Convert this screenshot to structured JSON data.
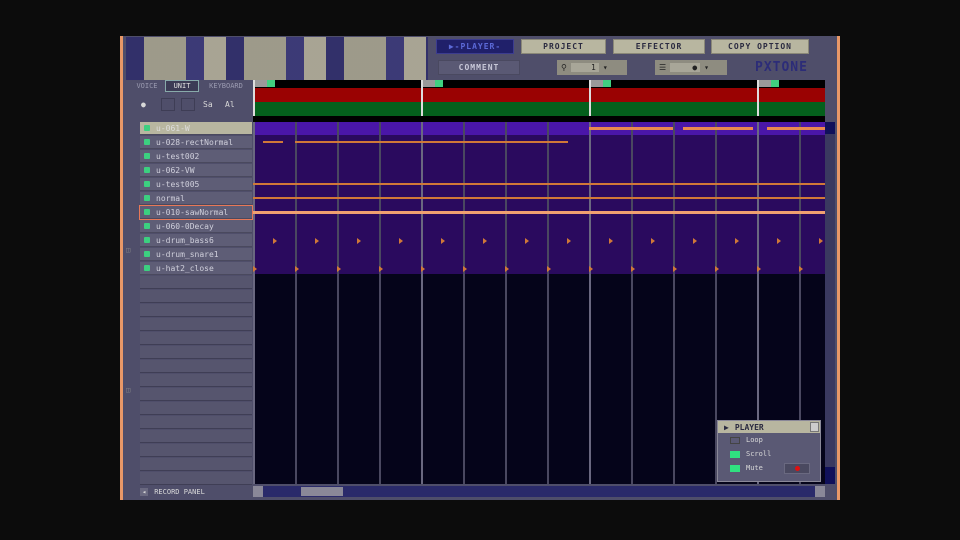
{
  "toolbar": {
    "player": "▶-PLAYER-",
    "project": "PROJECT",
    "effector": "EFFECTOR",
    "copy_option": "COPY OPTION",
    "comment": "COMMENT",
    "zoom_value": "1",
    "logo": "PXTONE"
  },
  "tabs": [
    {
      "label": "VOICE"
    },
    {
      "label": "UNIT"
    },
    {
      "label": "KEYBOARD"
    }
  ],
  "unit_tools": {
    "sa": "Sa",
    "al": "Al"
  },
  "units": [
    {
      "name": "u-061-W"
    },
    {
      "name": "u-028-rectNormal"
    },
    {
      "name": "u-test002"
    },
    {
      "name": "u-062-VW"
    },
    {
      "name": "u-test005"
    },
    {
      "name": "normal"
    },
    {
      "name": "u-010-sawNormal"
    },
    {
      "name": "u-060-0Decay"
    },
    {
      "name": "u-drum_bass6"
    },
    {
      "name": "u-drum_snare1"
    },
    {
      "name": "u-hat2_close"
    }
  ],
  "footer": {
    "record_panel": "RECORD PANEL"
  },
  "player_panel": {
    "title": "PLAYER",
    "loop": "Loop",
    "scroll": "Scroll",
    "mute": "Mute",
    "loop_on": false,
    "scroll_on": true,
    "mute_on": true
  },
  "colors": {
    "accent": "#e89868",
    "track_bg": "#2a0a5e",
    "selected_row": "#4a16a8"
  }
}
